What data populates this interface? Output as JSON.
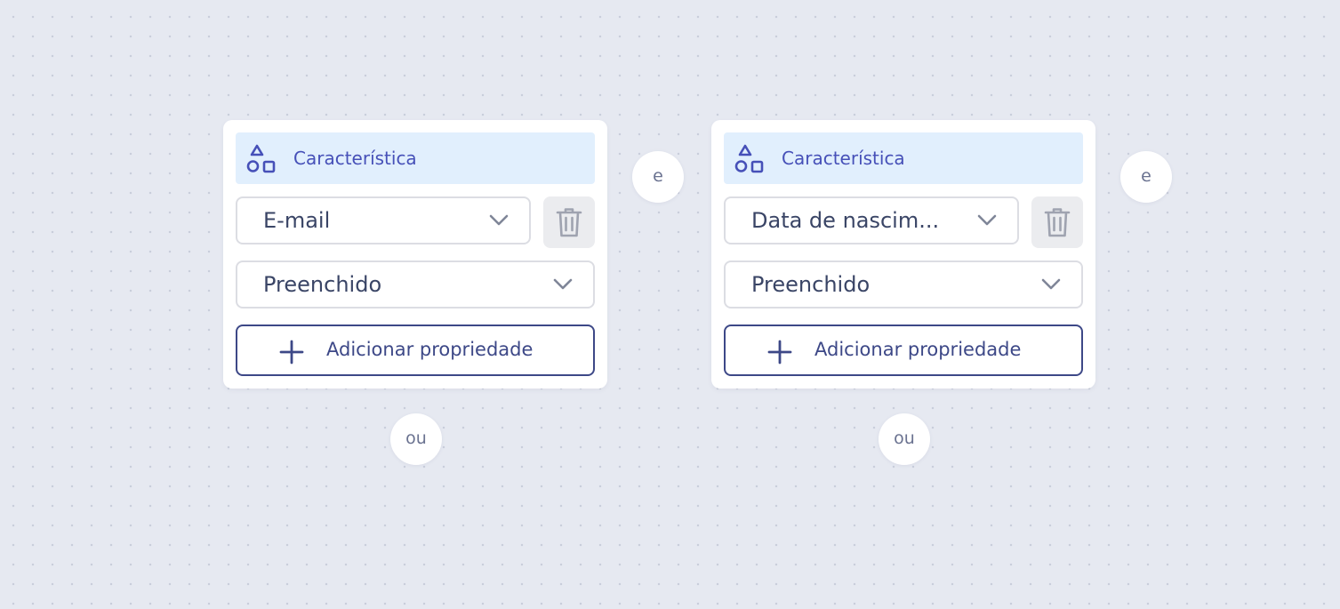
{
  "colors": {
    "canvas": "#e6e9f1",
    "card": "#ffffff",
    "header_bg": "#e1effd",
    "accent": "#4650b8",
    "button_border": "#3d4887",
    "input_text": "#3a4566",
    "disabled_icon": "#9fa3b0"
  },
  "condition_groups": [
    {
      "header": {
        "icon": "shapes-icon",
        "label": "Característica"
      },
      "attribute_select": {
        "value": "E-mail",
        "icon": "chevron-down-icon"
      },
      "delete_button": {
        "icon": "trash-icon",
        "disabled": true
      },
      "operator_select": {
        "value": "Preenchido",
        "icon": "chevron-down-icon"
      },
      "add_button": {
        "icon": "plus-icon",
        "label": "Adicionar propriedade"
      },
      "and_connector": "e",
      "or_connector": "ou"
    },
    {
      "header": {
        "icon": "shapes-icon",
        "label": "Característica"
      },
      "attribute_select": {
        "value": "Data de nascim...",
        "icon": "chevron-down-icon"
      },
      "delete_button": {
        "icon": "trash-icon",
        "disabled": true
      },
      "operator_select": {
        "value": "Preenchido",
        "icon": "chevron-down-icon"
      },
      "add_button": {
        "icon": "plus-icon",
        "label": "Adicionar propriedade"
      },
      "and_connector": "e",
      "or_connector": "ou"
    }
  ]
}
